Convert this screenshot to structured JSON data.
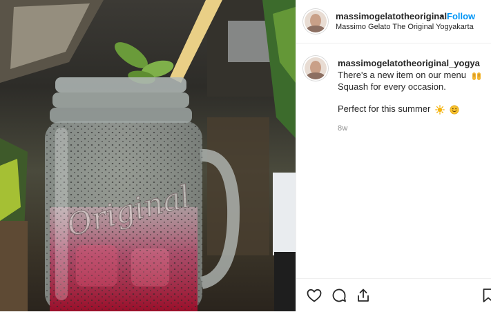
{
  "post": {
    "username": "massimogelatotheoriginal",
    "separator": "•",
    "follow_label": "Follow",
    "location": "Massimo Gelato The Original Yogyakarta"
  },
  "caption": {
    "username": "massimogelatotheoriginal_yogya",
    "line1": "There's a new item on our menu",
    "line2": "Squash for every occasion.",
    "line3": "Perfect for this summer",
    "time": "8w"
  },
  "photo": {
    "jar_text": "Original"
  },
  "actions": {
    "icons": [
      "heart-icon",
      "comment-icon",
      "share-icon",
      "bookmark-icon"
    ]
  },
  "colors": {
    "follow": "#0095f6",
    "text": "#262626",
    "muted": "#8e8e8e",
    "drink": "#b0122e"
  }
}
